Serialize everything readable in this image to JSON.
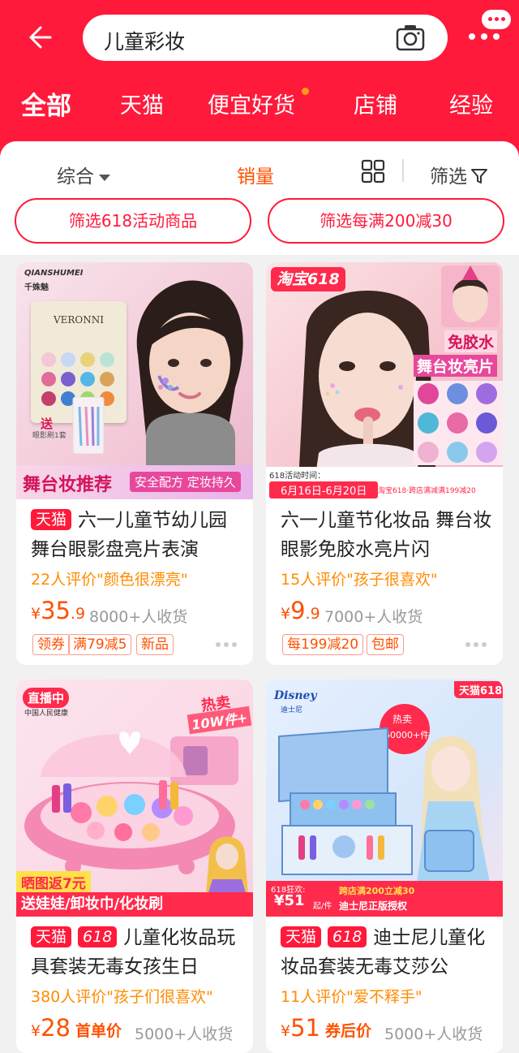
{
  "search": {
    "query": "儿童彩妆"
  },
  "tabs": [
    "全部",
    "天猫",
    "便宜好货",
    "店铺",
    "经验"
  ],
  "sort": {
    "comprehensive": "综合",
    "sales": "销量",
    "filter": "筛选"
  },
  "promo_filters": [
    "筛选618活动商品",
    "筛选每满200减30"
  ],
  "colors": {
    "brand": "#ff1a3c",
    "price": "#ff5000",
    "review": "#ff8c00"
  },
  "products": [
    {
      "badges": [
        "天猫"
      ],
      "title": "六一儿童节幼儿园舞台眼影盘亮片表演",
      "reviews": "22人评价\"颜色很漂亮\"",
      "price_currency": "¥",
      "price_int": "35",
      "price_dec": ".9",
      "sold": "8000+人收货",
      "tags": [
        "领券",
        "满79减5",
        "新品"
      ],
      "image": {
        "brand": "QIANSHUMEI",
        "brand_sub": "千姝魅",
        "palette": "VERONNI",
        "gift": "送",
        "gift_sub": "眼影刷1套",
        "banner": "舞台妆推荐",
        "banner_tag": "安全配方 定妆持久"
      }
    },
    {
      "badges": [],
      "title": "六一儿童节化妆品 舞台妆眼影免胶水亮片闪",
      "reviews": "15人评价\"孩子很喜欢\"",
      "price_currency": "¥",
      "price_int": "9",
      "price_dec": ".9",
      "sold": "7000+人收货",
      "tags": [
        "每199减20",
        "包邮"
      ],
      "image": {
        "badge": "淘宝618",
        "side1": "免胶水",
        "side2": "舞台妆亮片",
        "event_label": "618活动时间：",
        "event_dates": "6月16日-6月20日",
        "event_promo": "淘宝618·跨店满减满199减20"
      }
    },
    {
      "badges": [
        "天猫",
        "618"
      ],
      "title": "儿童化妆品玩具套装无毒女孩生日",
      "reviews": "380人评价\"孩子们很喜欢\"",
      "price_currency": "¥",
      "price_int": "28",
      "price_prefix": "首单价",
      "sold": "5000+人收货",
      "image": {
        "live": "直播中",
        "media": "中国人民健康",
        "hot": "热卖",
        "hot_count": "10W件+",
        "ribbon1": "晒图返7元",
        "ribbon2": "送娃娃/卸妆巾/化妆刷"
      }
    },
    {
      "badges": [
        "天猫",
        "618"
      ],
      "title": "迪士尼儿童化妆品套装无毒艾莎公",
      "reviews": "11人评价\"爱不释手\"",
      "price_currency": "¥",
      "price_int": "51",
      "price_prefix": "券后价",
      "sold": "5000+人收货",
      "image": {
        "corner": "天猫618",
        "disney": "Disney",
        "disney_sub": "迪士尼",
        "hot": "热卖",
        "hot_count": "60000+件",
        "sale_label": "618狂欢:",
        "sale_price": "¥51",
        "sale_unit": "起/件",
        "sale_promo": "跨店满200立减30",
        "sale_auth": "迪士尼正版授权"
      }
    }
  ]
}
